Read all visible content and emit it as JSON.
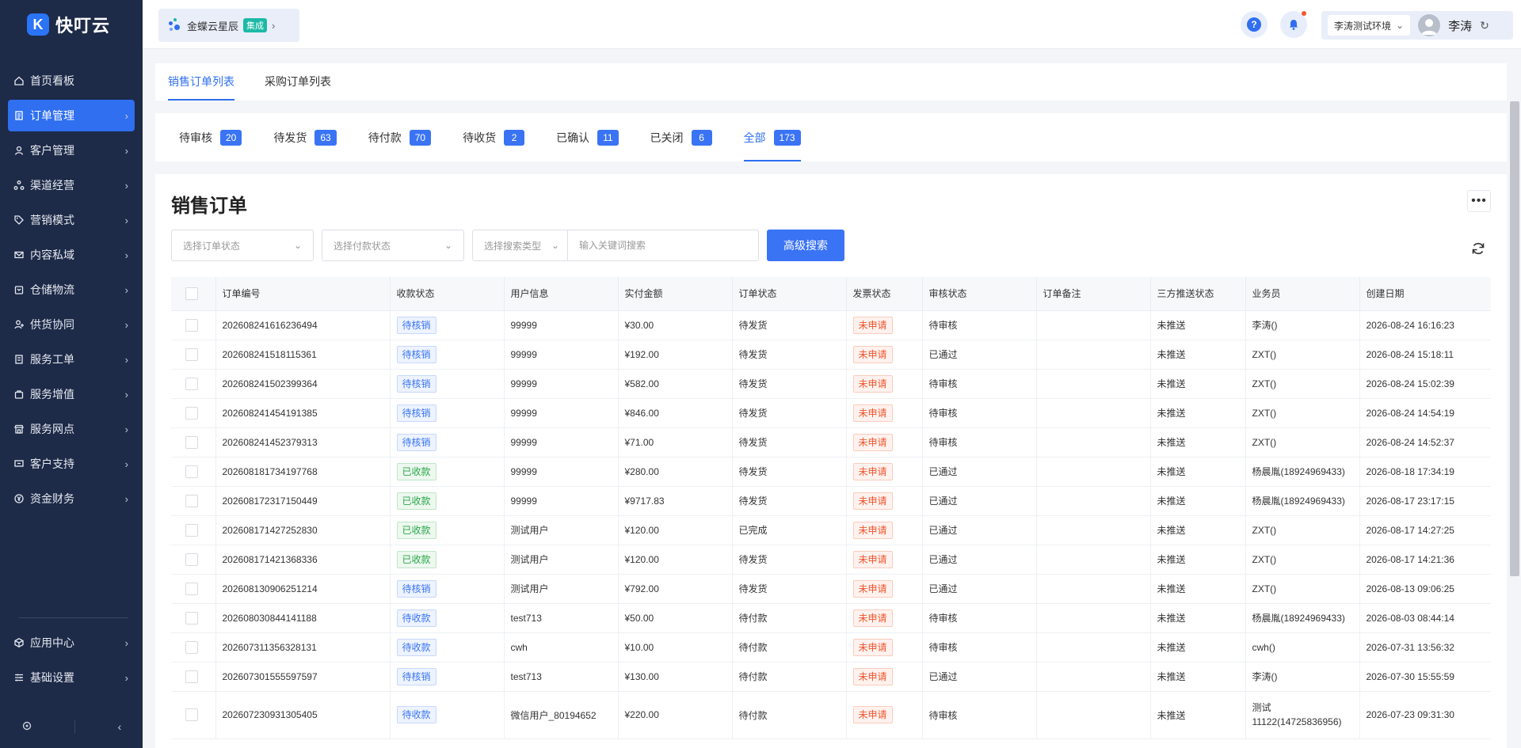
{
  "app": {
    "logo_text": "快叮云"
  },
  "sidebar": {
    "items": [
      {
        "label": "首页看板",
        "icon": "home-icon",
        "active": false,
        "arrow": false
      },
      {
        "label": "订单管理",
        "icon": "document-icon",
        "active": true,
        "arrow": true
      },
      {
        "label": "客户管理",
        "icon": "user-icon",
        "active": false,
        "arrow": true
      },
      {
        "label": "渠道经营",
        "icon": "channel-icon",
        "active": false,
        "arrow": true
      },
      {
        "label": "营销模式",
        "icon": "tag-icon",
        "active": false,
        "arrow": true
      },
      {
        "label": "内容私域",
        "icon": "mail-icon",
        "active": false,
        "arrow": true
      },
      {
        "label": "仓储物流",
        "icon": "box-icon",
        "active": false,
        "arrow": true
      },
      {
        "label": "供货协同",
        "icon": "supply-icon",
        "active": false,
        "arrow": true
      },
      {
        "label": "服务工单",
        "icon": "ticket-icon",
        "active": false,
        "arrow": true
      },
      {
        "label": "服务增值",
        "icon": "bag-icon",
        "active": false,
        "arrow": true
      },
      {
        "label": "服务网点",
        "icon": "store-icon",
        "active": false,
        "arrow": true
      },
      {
        "label": "客户支持",
        "icon": "support-icon",
        "active": false,
        "arrow": true
      },
      {
        "label": "资金财务",
        "icon": "yen-icon",
        "active": false,
        "arrow": true
      }
    ],
    "bottom_items": [
      {
        "label": "应用中心",
        "icon": "cube-icon"
      },
      {
        "label": "基础设置",
        "icon": "settings-list-icon"
      }
    ]
  },
  "header": {
    "brand_name": "金蝶云星辰",
    "brand_badge": "集成",
    "env_label": "李涛测试环境",
    "user_name": "李涛"
  },
  "top_tabs": [
    {
      "label": "销售订单列表",
      "active": true
    },
    {
      "label": "采购订单列表",
      "active": false
    }
  ],
  "status_tabs": [
    {
      "label": "待审核",
      "count": "20"
    },
    {
      "label": "待发货",
      "count": "63"
    },
    {
      "label": "待付款",
      "count": "70"
    },
    {
      "label": "待收货",
      "count": "2"
    },
    {
      "label": "已确认",
      "count": "11"
    },
    {
      "label": "已关闭",
      "count": "6"
    },
    {
      "label": "全部",
      "count": "173",
      "active": true
    }
  ],
  "main": {
    "title": "销售订单",
    "filters": {
      "order_status_placeholder": "选择订单状态",
      "pay_status_placeholder": "选择付款状态",
      "search_type_placeholder": "选择搜索类型",
      "keyword_placeholder": "输入关键词搜索",
      "advanced_search_label": "高级搜索"
    }
  },
  "table": {
    "columns": [
      "订单编号",
      "收款状态",
      "用户信息",
      "实付金额",
      "订单状态",
      "发票状态",
      "审核状态",
      "订单备注",
      "三方推送状态",
      "业务员",
      "创建日期"
    ],
    "rows": [
      {
        "id": "202608241616236494",
        "pay": "待核销",
        "user": "99999",
        "amount": "¥30.00",
        "status": "待发货",
        "invoice": "未申请",
        "audit": "待审核",
        "note": "",
        "push": "未推送",
        "sales": "李涛()",
        "date": "2026-08-24 16:16:23"
      },
      {
        "id": "202608241518115361",
        "pay": "待核销",
        "user": "99999",
        "amount": "¥192.00",
        "status": "待发货",
        "invoice": "未申请",
        "audit": "已通过",
        "note": "",
        "push": "未推送",
        "sales": "ZXT()",
        "date": "2026-08-24 15:18:11"
      },
      {
        "id": "202608241502399364",
        "pay": "待核销",
        "user": "99999",
        "amount": "¥582.00",
        "status": "待发货",
        "invoice": "未申请",
        "audit": "待审核",
        "note": "",
        "push": "未推送",
        "sales": "ZXT()",
        "date": "2026-08-24 15:02:39"
      },
      {
        "id": "202608241454191385",
        "pay": "待核销",
        "user": "99999",
        "amount": "¥846.00",
        "status": "待发货",
        "invoice": "未申请",
        "audit": "待审核",
        "note": "",
        "push": "未推送",
        "sales": "ZXT()",
        "date": "2026-08-24 14:54:19"
      },
      {
        "id": "202608241452379313",
        "pay": "待核销",
        "user": "99999",
        "amount": "¥71.00",
        "status": "待发货",
        "invoice": "未申请",
        "audit": "待审核",
        "note": "",
        "push": "未推送",
        "sales": "ZXT()",
        "date": "2026-08-24 14:52:37"
      },
      {
        "id": "202608181734197768",
        "pay": "已收款",
        "user": "99999",
        "amount": "¥280.00",
        "status": "待发货",
        "invoice": "未申请",
        "audit": "已通过",
        "note": "",
        "push": "未推送",
        "sales": "杨晨胤(18924969433)",
        "date": "2026-08-18 17:34:19"
      },
      {
        "id": "202608172317150449",
        "pay": "已收款",
        "user": "99999",
        "amount": "¥9717.83",
        "status": "待发货",
        "invoice": "未申请",
        "audit": "已通过",
        "note": "",
        "push": "未推送",
        "sales": "杨晨胤(18924969433)",
        "date": "2026-08-17 23:17:15"
      },
      {
        "id": "202608171427252830",
        "pay": "已收款",
        "user": "测试用户",
        "amount": "¥120.00",
        "status": "已完成",
        "invoice": "未申请",
        "audit": "已通过",
        "note": "",
        "push": "未推送",
        "sales": "ZXT()",
        "date": "2026-08-17 14:27:25"
      },
      {
        "id": "202608171421368336",
        "pay": "已收款",
        "user": "测试用户",
        "amount": "¥120.00",
        "status": "待发货",
        "invoice": "未申请",
        "audit": "已通过",
        "note": "",
        "push": "未推送",
        "sales": "ZXT()",
        "date": "2026-08-17 14:21:36"
      },
      {
        "id": "202608130906251214",
        "pay": "待核销",
        "user": "测试用户",
        "amount": "¥792.00",
        "status": "待发货",
        "invoice": "未申请",
        "audit": "已通过",
        "note": "",
        "push": "未推送",
        "sales": "ZXT()",
        "date": "2026-08-13 09:06:25"
      },
      {
        "id": "202608030844141188",
        "pay": "待收款",
        "user": "test713",
        "amount": "¥50.00",
        "status": "待付款",
        "invoice": "未申请",
        "audit": "待审核",
        "note": "",
        "push": "未推送",
        "sales": "杨晨胤(18924969433)",
        "date": "2026-08-03 08:44:14"
      },
      {
        "id": "202607311356328131",
        "pay": "待收款",
        "user": "cwh",
        "amount": "¥10.00",
        "status": "待付款",
        "invoice": "未申请",
        "audit": "待审核",
        "note": "",
        "push": "未推送",
        "sales": "cwh()",
        "date": "2026-07-31 13:56:32"
      },
      {
        "id": "202607301555597597",
        "pay": "待核销",
        "user": "test713",
        "amount": "¥130.00",
        "status": "待付款",
        "invoice": "未申请",
        "audit": "已通过",
        "note": "",
        "push": "未推送",
        "sales": "李涛()",
        "date": "2026-07-30 15:55:59"
      },
      {
        "id": "202607230931305405",
        "pay": "待收款",
        "user": "微信用户_80194652",
        "amount": "¥220.00",
        "status": "待付款",
        "invoice": "未申请",
        "audit": "待审核",
        "note": "",
        "push": "未推送",
        "sales": "测试11122(14725836956)",
        "date": "2026-07-23 09:31:30",
        "tall": true
      }
    ]
  },
  "colors": {
    "accent": "#2f6ff0",
    "sidebar_bg": "#1d2a48",
    "tag_blue": "#3a74f5",
    "tag_green": "#2ba84a",
    "tag_red": "#f1542d"
  }
}
